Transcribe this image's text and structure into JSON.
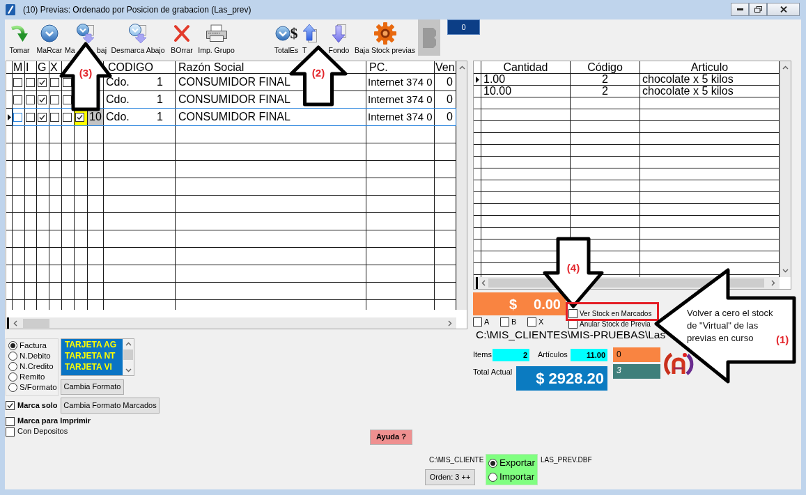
{
  "window": {
    "title": "(10) Previas: Ordenado por Posicion de grabacion (Las_prev)"
  },
  "toolbar": {
    "items": [
      {
        "kind": "take",
        "label": "Tomar",
        "disabled": false
      },
      {
        "kind": "mark",
        "label": "MaRcar",
        "disabled": false
      },
      {
        "kind": "mark_down",
        "label_parts": [
          "Ma",
          "baj"
        ],
        "disabled": false
      },
      {
        "kind": "unmark_down",
        "label": "Desmarca Abajo",
        "disabled": false
      },
      {
        "kind": "delete",
        "label": "BOrrar",
        "disabled": false
      },
      {
        "kind": "print",
        "label": "Imp. Grupo",
        "disabled": false
      },
      {
        "kind": "totals",
        "glyph": "$",
        "label": "TotalEs",
        "disabled": false
      },
      {
        "kind": "top",
        "label_parts": [
          "T"
        ],
        "disabled": false
      },
      {
        "kind": "bottom",
        "label": "Fondo",
        "disabled": false
      },
      {
        "kind": "gear",
        "label": "Baja Stock previas",
        "disabled": false
      },
      {
        "kind": "blank",
        "disabled": true
      }
    ],
    "counter": "0"
  },
  "orders_grid": {
    "check_headers": [
      "M",
      "I",
      "G",
      "X"
    ],
    "headers": [
      "CODIGO",
      "Razón Social",
      "PC.",
      "Ven"
    ],
    "rows": [
      {
        "selected": false,
        "checks": [
          false,
          false,
          true,
          false,
          false
        ],
        "codigo_parts": [
          "Cdo.",
          "1"
        ],
        "razon_social": "CONSUMIDOR FINAL",
        "pc": "Internet 374 0",
        "vend": "0"
      },
      {
        "selected": false,
        "checks": [
          false,
          false,
          true,
          false,
          false
        ],
        "codigo_parts": [
          "Cdo.",
          "1"
        ],
        "razon_social": "CONSUMIDOR FINAL",
        "pc": "Internet 374 0",
        "vend": "0"
      },
      {
        "selected": true,
        "checks": [
          false,
          false,
          true,
          false,
          false
        ],
        "marked": true,
        "number": "10",
        "codigo_parts": [
          "Cdo.",
          "1"
        ],
        "razon_social": "CONSUMIDOR FINAL",
        "pc": "Internet 374 0",
        "vend": "0"
      }
    ]
  },
  "items_grid": {
    "headers": [
      "Cantidad",
      "Código",
      "Articulo"
    ],
    "rows": [
      {
        "selected": true,
        "cantidad": "1.00",
        "codigo": "2",
        "articulo": "chocolate x 5 kilos"
      },
      {
        "selected": false,
        "cantidad": "10.00",
        "codigo": "2",
        "articulo": "chocolate x 5 kilos"
      }
    ]
  },
  "summary": {
    "marked_total": {
      "symbol": "$",
      "value": "0.00"
    },
    "filters": [
      {
        "label": "A",
        "checked": false
      },
      {
        "label": "B",
        "checked": false
      },
      {
        "label": "X",
        "checked": false
      }
    ],
    "stock_options": [
      {
        "label": "Ver Stock en Marcados",
        "checked": false
      },
      {
        "label": "Anular Stock de Previa",
        "checked": false
      }
    ],
    "path": "C:\\MIS_CLIENTES\\MIS-PRUEBAS\\Las",
    "items_label": "Items",
    "items_value": "2",
    "articles_label": "Artículos",
    "articles_value": "11.00",
    "counter_1": "0",
    "counter_2": "3",
    "total_label": "Total Actual",
    "total_value": "$ 2928.20"
  },
  "document_types": [
    {
      "label": "Factura",
      "selected": true
    },
    {
      "label": "N.Debito",
      "selected": false
    },
    {
      "label": "N.Credito",
      "selected": false
    },
    {
      "label": "Remito",
      "selected": false
    },
    {
      "label": "S/Formato",
      "selected": false
    }
  ],
  "cards_list": [
    "TARJETA AG",
    "TARJETA NT",
    "TARJETA VI"
  ],
  "format_button": "Cambia Formato",
  "print_options": [
    {
      "label": "Marca solo",
      "checked": true,
      "bold": true
    },
    {
      "label": "Marca para Imprimir",
      "checked": false,
      "bold": true
    },
    {
      "label": "Con Depositos",
      "checked": false,
      "bold": false
    }
  ],
  "format_marked_button": "Cambia Formato Marcados",
  "help_button": "Ayuda ?",
  "file_path_parts": [
    "C:\\MIS_CLIENTE",
    "LAS_PREV.DBF"
  ],
  "order_button": "Orden: 3 ++",
  "transfer_modes": [
    {
      "label": "Exportar",
      "selected": true
    },
    {
      "label": "Importar",
      "selected": false
    }
  ],
  "annotations": [
    {
      "kind": "arrow_up",
      "label": "(3)"
    },
    {
      "kind": "arrow_up",
      "label": "(2)"
    },
    {
      "kind": "arrow_down",
      "label": "(4)"
    },
    {
      "kind": "frame"
    },
    {
      "kind": "callout",
      "text": "Volver a cero el stock de \"Virtual\" de las previas en curso",
      "label": "(1)"
    }
  ]
}
